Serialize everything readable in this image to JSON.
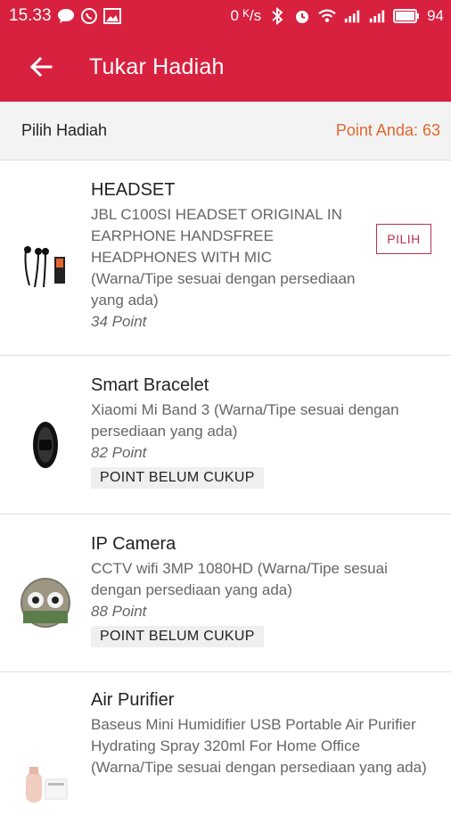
{
  "status_bar": {
    "time": "15.33",
    "net_speed": "0 ᴷ/s",
    "battery": "94"
  },
  "header": {
    "title": "Tukar Hadiah"
  },
  "subheader": {
    "left": "Pilih Hadiah",
    "right": "Point Anda: 63"
  },
  "items": [
    {
      "name": "HEADSET",
      "desc": "JBL C100SI HEADSET ORIGINAL IN EARPHONE HANDSFREE HEADPHONES WITH MIC (Warna/Tipe sesuai dengan persediaan yang ada)",
      "points": "34 Point",
      "action": "PILIH"
    },
    {
      "name": "Smart Bracelet",
      "desc": "Xiaomi Mi Band 3 (Warna/Tipe sesuai dengan persediaan yang ada)",
      "points": "82 Point",
      "badge": "POINT BELUM CUKUP"
    },
    {
      "name": "IP Camera",
      "desc": "CCTV wifi 3MP 1080HD (Warna/Tipe sesuai dengan persediaan yang ada)",
      "points": "88 Point",
      "badge": "POINT BELUM CUKUP"
    },
    {
      "name": "Air Purifier",
      "desc": "Baseus Mini Humidifier USB Portable Air Purifier Hydrating Spray 320ml For Home Office (Warna/Tipe sesuai dengan persediaan yang ada)"
    }
  ],
  "colors": {
    "brand": "#d8203f",
    "accent_orange": "#e2662f",
    "pilih_border": "#b5344c"
  }
}
